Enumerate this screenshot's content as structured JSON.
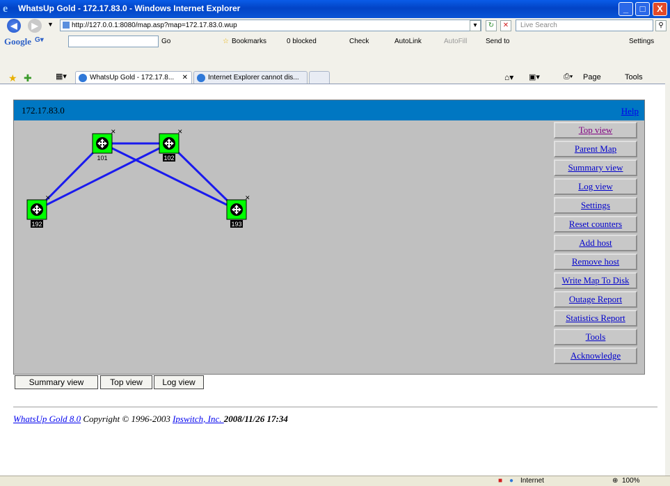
{
  "window": {
    "title": "WhatsUp Gold - 172.17.83.0 - Windows Internet Explorer",
    "controls": [
      "_",
      "□",
      "X"
    ]
  },
  "address_bar": {
    "url": "http://127.0.0.1:8080/map.asp?map=172.17.83.0.wup",
    "search_placeholder": "Live Search"
  },
  "google_toolbar": {
    "logo": "Google",
    "go_label": "Go",
    "bookmarks": "Bookmarks",
    "blocked": "0 blocked",
    "check": "Check",
    "autolink": "AutoLink",
    "autofill": "AutoFill",
    "sendto": "Send to",
    "settings": "Settings"
  },
  "tabs": [
    {
      "label": "WhatsUp Gold - 172.17.8...",
      "active": true
    },
    {
      "label": "Internet Explorer cannot dis...",
      "active": false
    }
  ],
  "command_bar": {
    "page": "Page",
    "tools": "Tools"
  },
  "map": {
    "title": "172.17.83.0",
    "help": "Help",
    "nodes": [
      {
        "label": "101",
        "status_color": "#00ff00"
      },
      {
        "label": "102",
        "status_color": "#00ff00"
      },
      {
        "label": "192",
        "status_color": "#00ff00"
      },
      {
        "label": "193",
        "status_color": "#00ff00"
      }
    ],
    "link_color": "#1a1aee",
    "links": [
      [
        "101",
        "102"
      ],
      [
        "101",
        "192"
      ],
      [
        "102",
        "192"
      ],
      [
        "101",
        "193"
      ],
      [
        "102",
        "193"
      ]
    ]
  },
  "sidebar": {
    "items": [
      {
        "label": "Top view",
        "visited": true
      },
      {
        "label": "Parent Map",
        "visited": false
      },
      {
        "label": "Summary view",
        "visited": false
      },
      {
        "label": "Log view",
        "visited": false
      },
      {
        "label": "Settings",
        "visited": false
      },
      {
        "label": "Reset counters",
        "visited": false
      },
      {
        "label": "Add host",
        "visited": false
      },
      {
        "label": "Remove host",
        "visited": false
      },
      {
        "label": "Write Map To Disk",
        "visited": false
      },
      {
        "label": "Outage Report",
        "visited": false
      },
      {
        "label": "Statistics Report",
        "visited": false
      },
      {
        "label": "Tools",
        "visited": false
      },
      {
        "label": "Acknowledge",
        "visited": false
      }
    ]
  },
  "bottom_buttons": {
    "summary": "Summary view",
    "top": "Top view",
    "log": "Log view"
  },
  "footer": {
    "product_link": "WhatsUp Gold 8.0",
    "copyright": " Copyright © 1996-2003 ",
    "company_link": "Ipswitch, Inc. ",
    "timestamp": "2008/11/26 17:34"
  },
  "status_bar": {
    "zone": "Internet",
    "zoom": "100%"
  }
}
